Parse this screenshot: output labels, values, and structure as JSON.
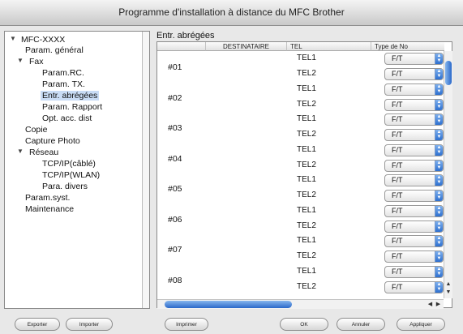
{
  "window": {
    "title": "Programme d'installation à distance du MFC Brother"
  },
  "tree": {
    "nodes": [
      {
        "label": "MFC-XXXX",
        "expanded": true
      },
      {
        "label": "Param. général"
      },
      {
        "label": "Fax",
        "expanded": true
      },
      {
        "label": "Param.RC."
      },
      {
        "label": "Param. TX."
      },
      {
        "label": "Entr. abrégées",
        "selected": true
      },
      {
        "label": "Param. Rapport"
      },
      {
        "label": "Opt. acc. dist"
      },
      {
        "label": "Copie"
      },
      {
        "label": "Capture Photo"
      },
      {
        "label": "Réseau",
        "expanded": true
      },
      {
        "label": "TCP/IP(câblé)"
      },
      {
        "label": "TCP/IP(WLAN)"
      },
      {
        "label": "Para. divers"
      },
      {
        "label": "Param.syst."
      },
      {
        "label": "Maintenance"
      }
    ]
  },
  "main": {
    "title": "Entr. abrégées",
    "columns": [
      "",
      "DESTINATAIRE",
      "TEL",
      "Type de No"
    ],
    "entries": [
      {
        "id": "#01",
        "tels": [
          "TEL1",
          "TEL2"
        ],
        "types": [
          "F/T",
          "F/T"
        ]
      },
      {
        "id": "#02",
        "tels": [
          "TEL1",
          "TEL2"
        ],
        "types": [
          "F/T",
          "F/T"
        ]
      },
      {
        "id": "#03",
        "tels": [
          "TEL1",
          "TEL2"
        ],
        "types": [
          "F/T",
          "F/T"
        ]
      },
      {
        "id": "#04",
        "tels": [
          "TEL1",
          "TEL2"
        ],
        "types": [
          "F/T",
          "F/T"
        ]
      },
      {
        "id": "#05",
        "tels": [
          "TEL1",
          "TEL2"
        ],
        "types": [
          "F/T",
          "F/T"
        ]
      },
      {
        "id": "#06",
        "tels": [
          "TEL1",
          "TEL2"
        ],
        "types": [
          "F/T",
          "F/T"
        ]
      },
      {
        "id": "#07",
        "tels": [
          "TEL1",
          "TEL2"
        ],
        "types": [
          "F/T",
          "F/T"
        ]
      },
      {
        "id": "#08",
        "tels": [
          "TEL1",
          "TEL2"
        ],
        "types": [
          "F/T",
          "F/T"
        ]
      }
    ]
  },
  "buttons": {
    "export": "Exporter",
    "import": "Importer",
    "print": "Imprimer",
    "ok": "OK",
    "cancel": "Annuler",
    "apply": "Appliquer"
  },
  "icons": {
    "tree_expanded": "disclosure-triangle-down-icon",
    "popup_arrows": "up-down-arrows-icon",
    "scroll_up": "arrow-up-icon",
    "scroll_down": "arrow-down-icon",
    "scroll_left": "arrow-left-icon",
    "scroll_right": "arrow-right-icon"
  },
  "colors": {
    "selection": "#c9dcf5",
    "accent": "#2d6fcf"
  }
}
